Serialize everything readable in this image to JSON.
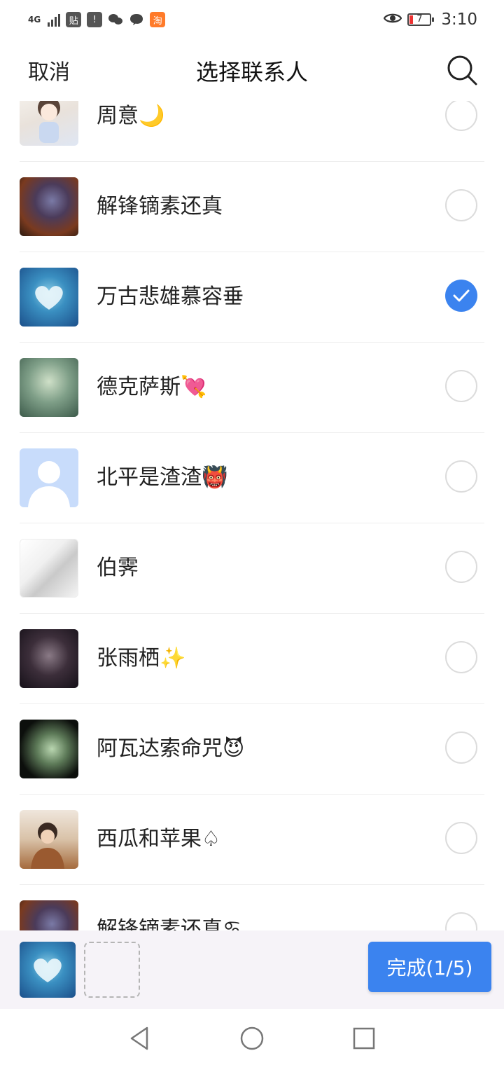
{
  "status_bar": {
    "network": "4G",
    "time": "3:10",
    "battery": "7",
    "notification_icons": [
      "tieba-icon",
      "alert-icon",
      "wechat-icon",
      "message-icon",
      "taobao-icon"
    ]
  },
  "header": {
    "cancel_label": "取消",
    "title": "选择联系人",
    "search_icon": "search-icon"
  },
  "contacts": [
    {
      "name": "周意🌙",
      "selected": false,
      "avatar": "girl"
    },
    {
      "name": "解锋镝素还真",
      "selected": false,
      "avatar": "warrior"
    },
    {
      "name": "万古悲雄慕容垂",
      "selected": true,
      "avatar": "heart-cloud"
    },
    {
      "name": "德克萨斯💘",
      "selected": false,
      "avatar": "fairy"
    },
    {
      "name": "北平是渣渣👹",
      "selected": false,
      "avatar": "default"
    },
    {
      "name": "伯霁",
      "selected": false,
      "avatar": "sketch"
    },
    {
      "name": "张雨栖✨",
      "selected": false,
      "avatar": "dark"
    },
    {
      "name": "阿瓦达索命咒😈",
      "selected": false,
      "avatar": "green"
    },
    {
      "name": "西瓜和苹果♤",
      "selected": false,
      "avatar": "boy"
    },
    {
      "name": "解锋镝素还真♋",
      "selected": false,
      "avatar": "warrior"
    }
  ],
  "selection": {
    "done_label": "完成(1/5)",
    "selected_count": 1,
    "max_count": 5
  },
  "colors": {
    "accent": "#3b83ef",
    "bottom_bar": "#f6f3f8"
  }
}
